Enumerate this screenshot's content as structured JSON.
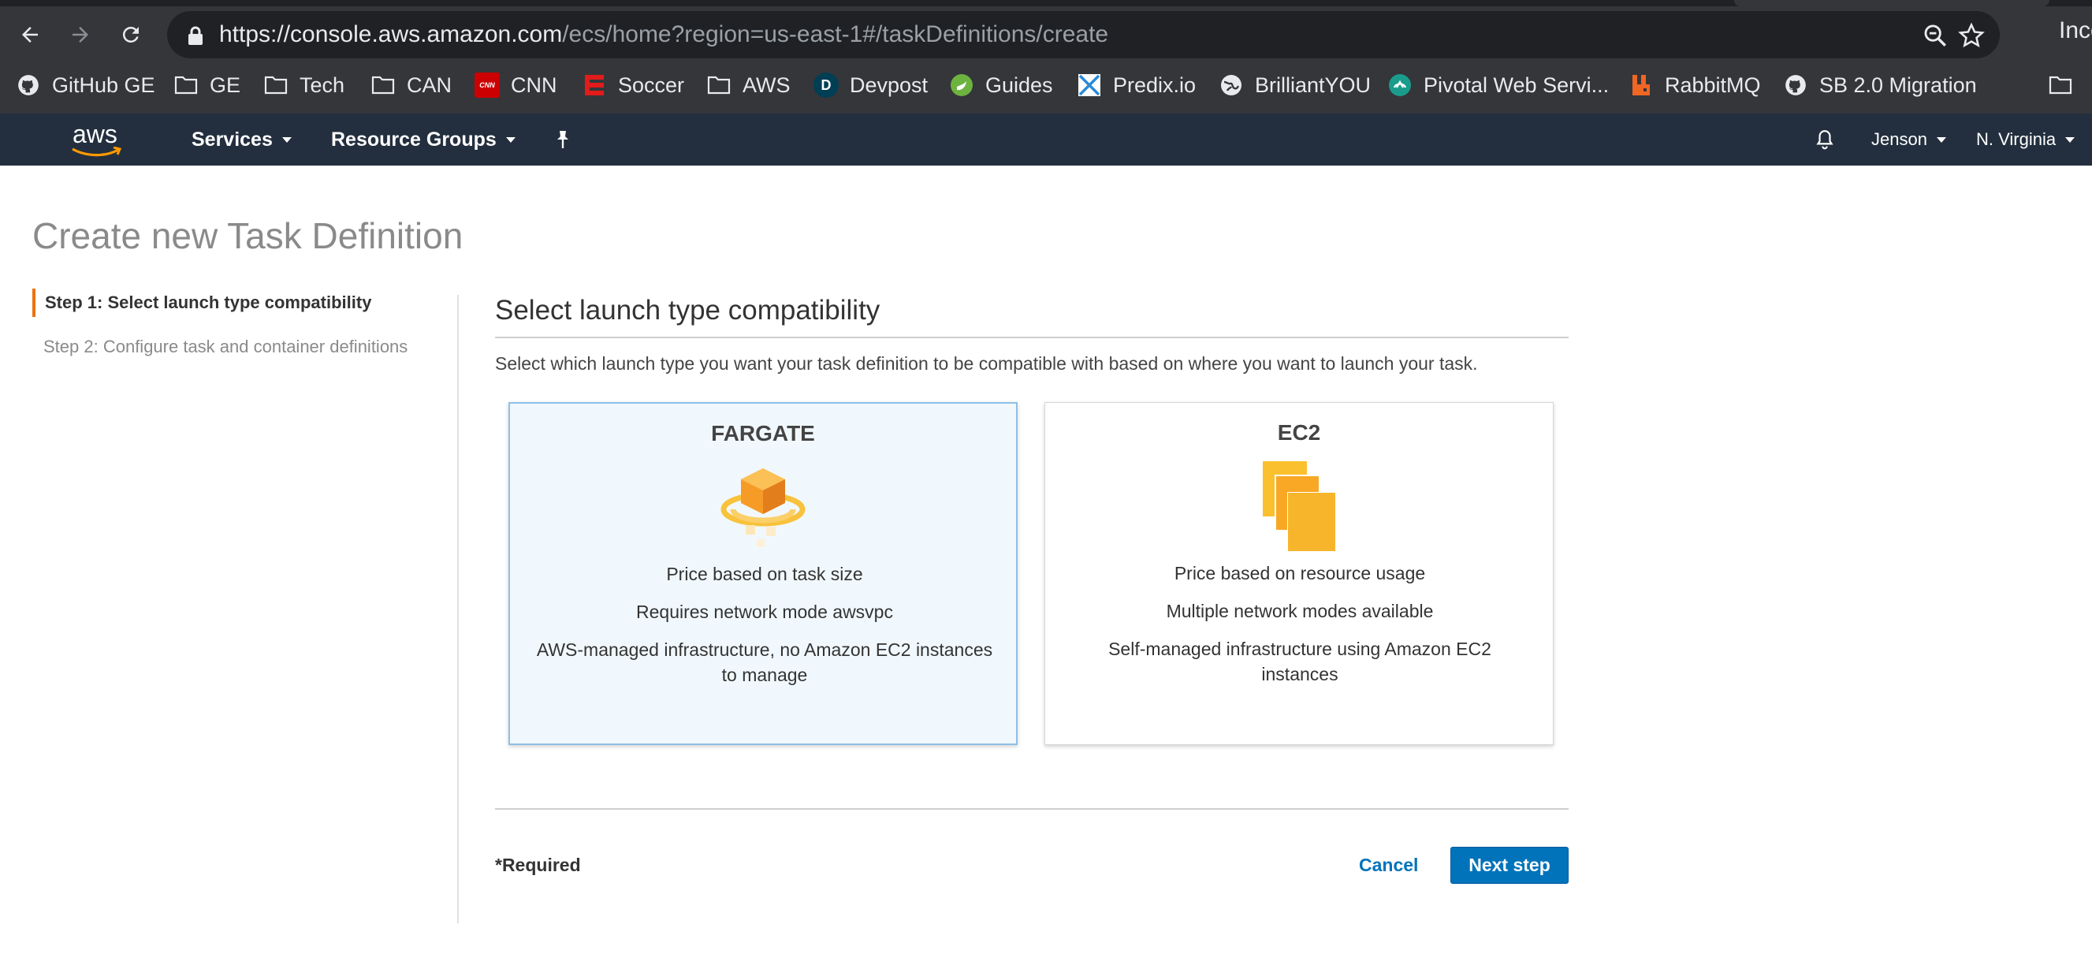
{
  "browser": {
    "url_host": "https://console.aws.amazon.com",
    "url_path": "/ecs/home?region=us-east-1#/taskDefinitions/create",
    "profile_label": "Inco",
    "bookmarks": [
      {
        "label": "GitHub GE",
        "icon": "github-icon"
      },
      {
        "label": "GE",
        "icon": "folder-icon"
      },
      {
        "label": "Tech",
        "icon": "folder-icon"
      },
      {
        "label": "CAN",
        "icon": "folder-icon"
      },
      {
        "label": "CNN",
        "icon": "cnn-icon",
        "icon_text": "CNN"
      },
      {
        "label": "Soccer",
        "icon": "soccer-icon"
      },
      {
        "label": "AWS",
        "icon": "folder-icon"
      },
      {
        "label": "Devpost",
        "icon": "devpost-icon",
        "icon_text": "D"
      },
      {
        "label": "Guides",
        "icon": "spring-icon"
      },
      {
        "label": "Predix.io",
        "icon": "predix-icon"
      },
      {
        "label": "BrilliantYOU",
        "icon": "globe-icon"
      },
      {
        "label": "Pivotal Web Servi...",
        "icon": "pivotal-icon"
      },
      {
        "label": "RabbitMQ",
        "icon": "rabbitmq-icon"
      },
      {
        "label": "SB 2.0 Migration",
        "icon": "github-icon"
      }
    ]
  },
  "aws_header": {
    "logo_text": "aws",
    "services_label": "Services",
    "resource_groups_label": "Resource Groups",
    "user_label": "Jenson",
    "region_label": "N. Virginia"
  },
  "page": {
    "title": "Create new Task Definition",
    "steps": [
      {
        "label": "Step 1: Select launch type compatibility"
      },
      {
        "label": "Step 2: Configure task and container definitions"
      }
    ],
    "section_title": "Select launch type compatibility",
    "section_description": "Select which launch type you want your task definition to be compatible with based on where you want to launch your task.",
    "cards": [
      {
        "title": "FARGATE",
        "line1": "Price based on task size",
        "line2": "Requires network mode awsvpc",
        "line3": "AWS-managed infrastructure, no Amazon EC2 instances to manage",
        "selected": true,
        "icon": "fargate-icon"
      },
      {
        "title": "EC2",
        "line1": "Price based on resource usage",
        "line2": "Multiple network modes available",
        "line3": "Self-managed infrastructure using Amazon EC2 instances",
        "selected": false,
        "icon": "ec2-icon"
      }
    ],
    "required_label": "*Required",
    "cancel_label": "Cancel",
    "next_label": "Next step"
  },
  "colors": {
    "aws_header_bg": "#232f3e",
    "accent_orange": "#ec7211",
    "primary_blue": "#0073bb",
    "selected_card_bg": "#f1f8fd"
  }
}
